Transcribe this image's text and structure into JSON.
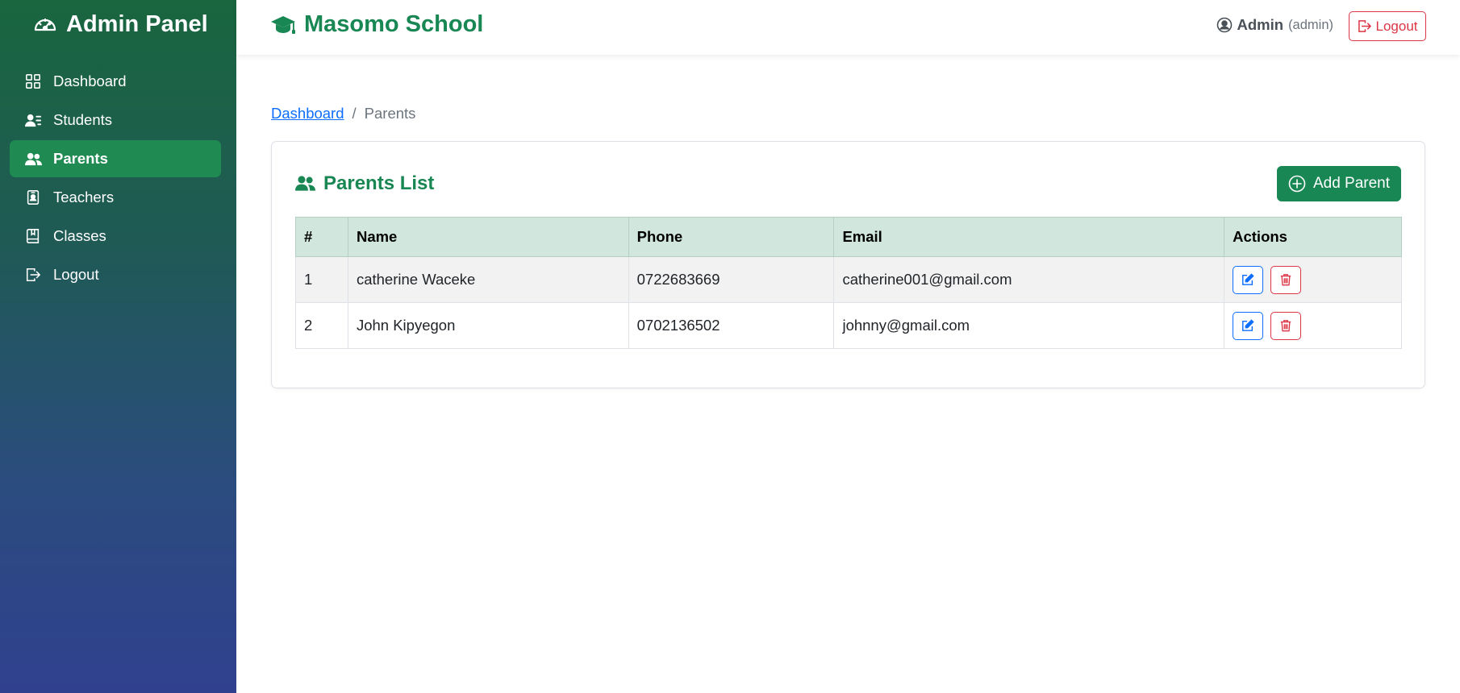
{
  "sidebar": {
    "brand": "Admin Panel",
    "brand_icon": "speedometer-icon",
    "items": [
      {
        "label": "Dashboard",
        "icon": "grid-icon",
        "active": false
      },
      {
        "label": "Students",
        "icon": "person-lines-icon",
        "active": false
      },
      {
        "label": "Parents",
        "icon": "people-icon",
        "active": true
      },
      {
        "label": "Teachers",
        "icon": "badge-icon",
        "active": false
      },
      {
        "label": "Classes",
        "icon": "book-icon",
        "active": false
      },
      {
        "label": "Logout",
        "icon": "box-arrow-right-icon",
        "active": false
      }
    ]
  },
  "topbar": {
    "school_name": "Masomo School",
    "school_icon": "mortarboard-icon",
    "user_name": "Admin",
    "user_role": "(admin)",
    "logout_label": "Logout"
  },
  "breadcrumb": {
    "home": "Dashboard",
    "separator": "/",
    "current": "Parents"
  },
  "card": {
    "title": "Parents List",
    "add_button": "Add Parent"
  },
  "table": {
    "headers": [
      "#",
      "Name",
      "Phone",
      "Email",
      "Actions"
    ],
    "rows": [
      {
        "num": "1",
        "name": "catherine Waceke",
        "phone": "0722683669",
        "email": "catherine001@gmail.com"
      },
      {
        "num": "2",
        "name": "John Kipyegon",
        "phone": "0702136502",
        "email": "johnny@gmail.com"
      }
    ]
  },
  "colors": {
    "primary_green": "#198754",
    "sidebar_top": "#19663f",
    "sidebar_bottom": "#30408f",
    "danger": "#dc3545",
    "link": "#0d6efd",
    "table_header": "#d1e7dd"
  }
}
